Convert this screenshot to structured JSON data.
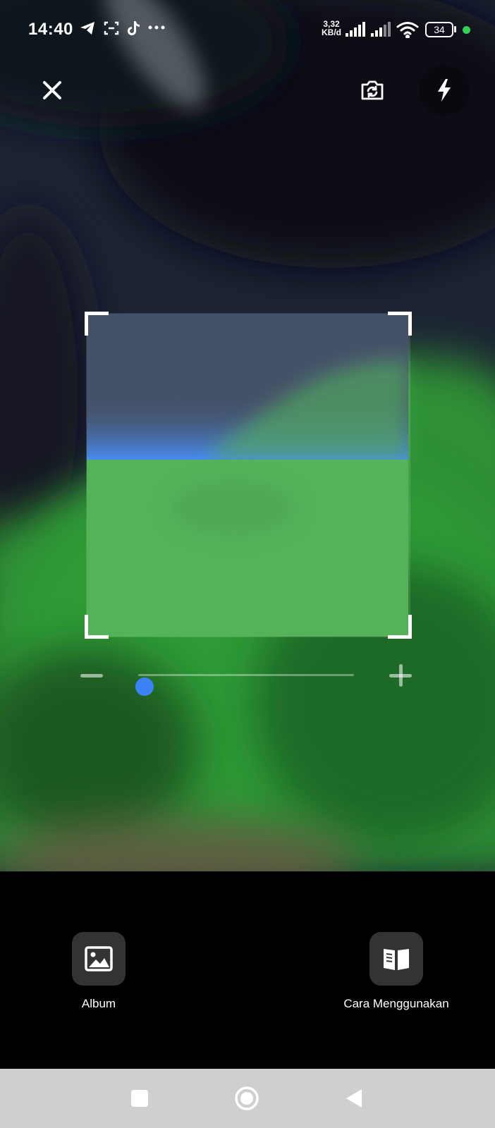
{
  "status_bar": {
    "time": "14:40",
    "net_speed_value": "3,32",
    "net_speed_unit": "KB/d",
    "battery": "34",
    "icons": [
      "telegram-icon",
      "screenshot-icon",
      "tiktok-icon",
      "more-dots-icon",
      "signal-icon",
      "signal-icon",
      "wifi-icon",
      "battery-icon",
      "charging-dot"
    ]
  },
  "top_controls": {
    "close_icon": "close-icon",
    "switch_camera_icon": "camera-switch-icon",
    "flash_icon": "flash-icon"
  },
  "zoom": {
    "level": 0.03
  },
  "actions": {
    "album_label": "Album",
    "album_icon": "image-icon",
    "guide_label": "Cara Menggunakan",
    "guide_icon": "book-icon"
  },
  "nav_bar": {
    "recent_icon": "square-icon",
    "home_icon": "circle-icon",
    "back_icon": "triangle-back-icon"
  },
  "colors": {
    "accent": "#3b82f6",
    "charging_dot": "#34d058",
    "action_button_bg": "#333333",
    "nav_bar_bg": "#cfcfcf"
  }
}
